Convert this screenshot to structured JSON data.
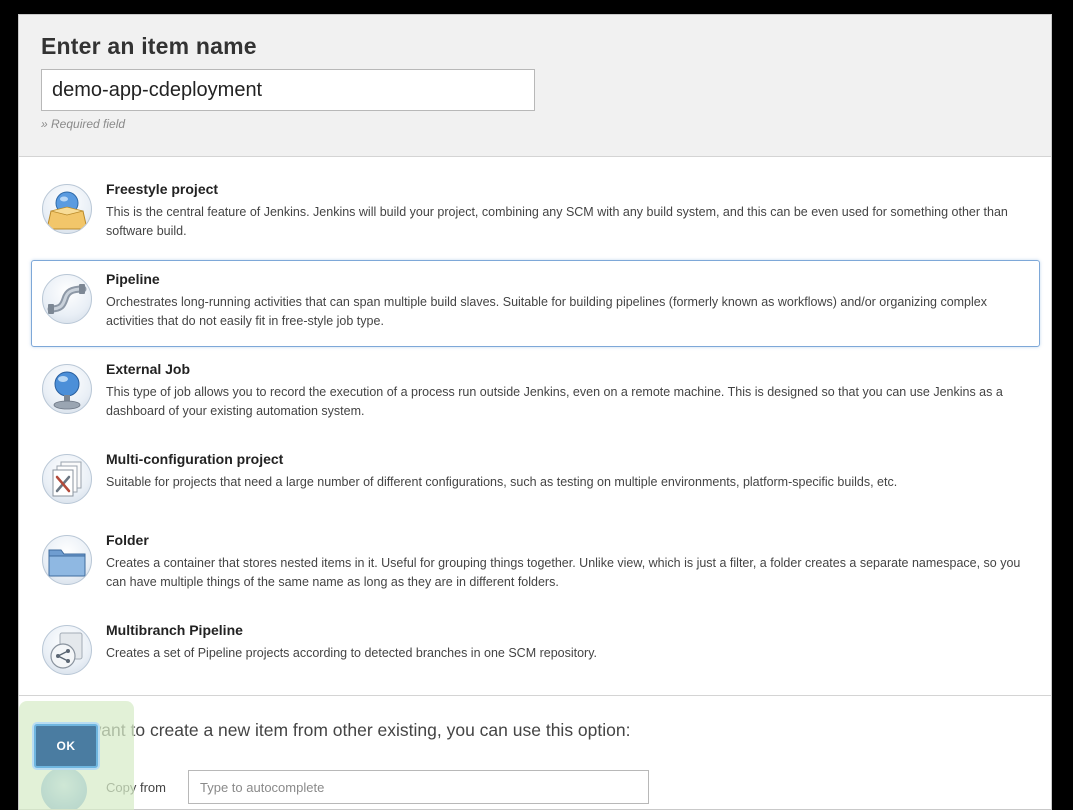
{
  "header": {
    "title": "Enter an item name",
    "name_value": "demo-app-cdeployment",
    "required_note": "» Required field"
  },
  "items": [
    {
      "title": "Freestyle project",
      "description": "This is the central feature of Jenkins. Jenkins will build your project, combining any SCM with any build system, and this can be even used for something other than software build.",
      "icon": "freestyle-project-icon"
    },
    {
      "title": "Pipeline",
      "description": "Orchestrates long-running activities that can span multiple build slaves. Suitable for building pipelines (formerly known as workflows) and/or organizing complex activities that do not easily fit in free-style job type.",
      "icon": "pipeline-icon",
      "selected": true
    },
    {
      "title": "External Job",
      "description": "This type of job allows you to record the execution of a process run outside Jenkins, even on a remote machine. This is designed so that you can use Jenkins as a dashboard of your existing automation system.",
      "icon": "external-job-icon"
    },
    {
      "title": "Multi-configuration project",
      "description": "Suitable for projects that need a large number of different configurations, such as testing on multiple environments, platform-specific builds, etc.",
      "icon": "multi-configuration-icon"
    },
    {
      "title": "Folder",
      "description": "Creates a container that stores nested items in it. Useful for grouping things together. Unlike view, which is just a filter, a folder creates a separate namespace, so you can have multiple things of the same name as long as they are in different folders.",
      "icon": "folder-icon"
    },
    {
      "title": "Multibranch Pipeline",
      "description": "Creates a set of Pipeline projects according to detected branches in one SCM repository.",
      "icon": "multibranch-pipeline-icon"
    }
  ],
  "copy_from": {
    "intro": "If you want to create a new item from other existing, you can use this option:",
    "label": "Copy from",
    "placeholder": "Type to autocomplete"
  },
  "ok_button": "OK",
  "colors": {
    "selected_border": "#7ea8d8",
    "ok_button_bg": "#4a7ca1",
    "header_bg": "#f1f1f1"
  }
}
